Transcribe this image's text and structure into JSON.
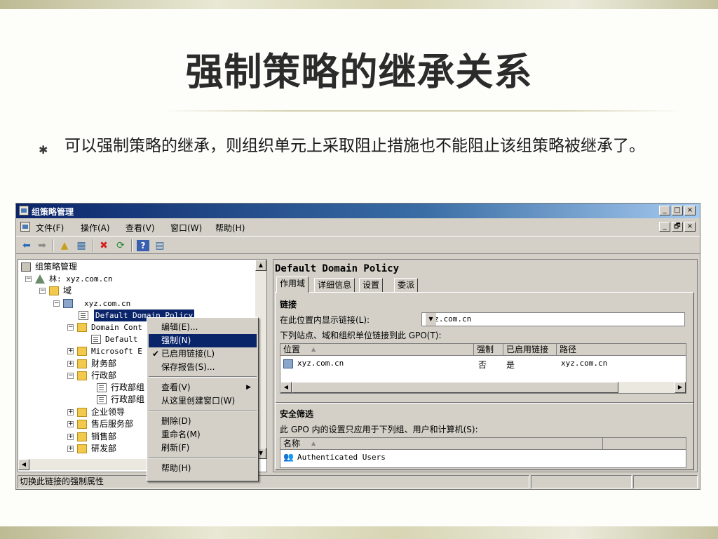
{
  "slide": {
    "title": "强制策略的继承关系",
    "bullet_mark": "✱",
    "bullet_text": "可以强制策略的继承，则组织单元上采取阻止措施也不能阻止该组策略被继承了。"
  },
  "window": {
    "title": "组策略管理",
    "minimize": "_",
    "maximize": "□",
    "close": "×",
    "restore": "🗗"
  },
  "menubar": [
    "文件(F)",
    "操作(A)",
    "查看(V)",
    "窗口(W)",
    "帮助(H)"
  ],
  "tree": {
    "root": "组策略管理",
    "forest": "林: xyz.com.cn",
    "domains": "域",
    "domain": "xyz.com.cn",
    "items": [
      "Default Domain Policy",
      "Domain Cont",
      "Default",
      "Microsoft E",
      "财务部",
      "行政部",
      "行政部组",
      "行政部组",
      "企业领导",
      "售后服务部",
      "销售部",
      "研发部"
    ]
  },
  "context_menu": {
    "items": [
      "编辑(E)...",
      "强制(N)",
      "已启用链接(L)",
      "保存报告(S)...",
      "查看(V)",
      "从这里创建窗口(W)",
      "删除(D)",
      "重命名(M)",
      "刷新(F)",
      "帮助(H)"
    ]
  },
  "details": {
    "gpo_name": "Default Domain Policy",
    "tabs": [
      "作用域",
      "详细信息",
      "设置",
      "委派"
    ],
    "links_header": "链接",
    "display_links_label": "在此位置内显示链接(L):",
    "location_value": "xyz.com.cn",
    "linked_label": "下列站点、域和组织单位链接到此 GPO(T):",
    "links_columns": [
      "位置",
      "强制",
      "已启用链接",
      "路径"
    ],
    "links_rows": [
      {
        "location": "xyz.com.cn",
        "enforced": "否",
        "enabled": "是",
        "path": "xyz.com.cn"
      }
    ],
    "security_header": "安全筛选",
    "security_label": "此 GPO 内的设置只应用于下列组、用户和计算机(S):",
    "security_columns": [
      "名称"
    ],
    "security_rows": [
      "Authenticated Users"
    ]
  },
  "status": {
    "text": "切换此链接的强制属性"
  }
}
